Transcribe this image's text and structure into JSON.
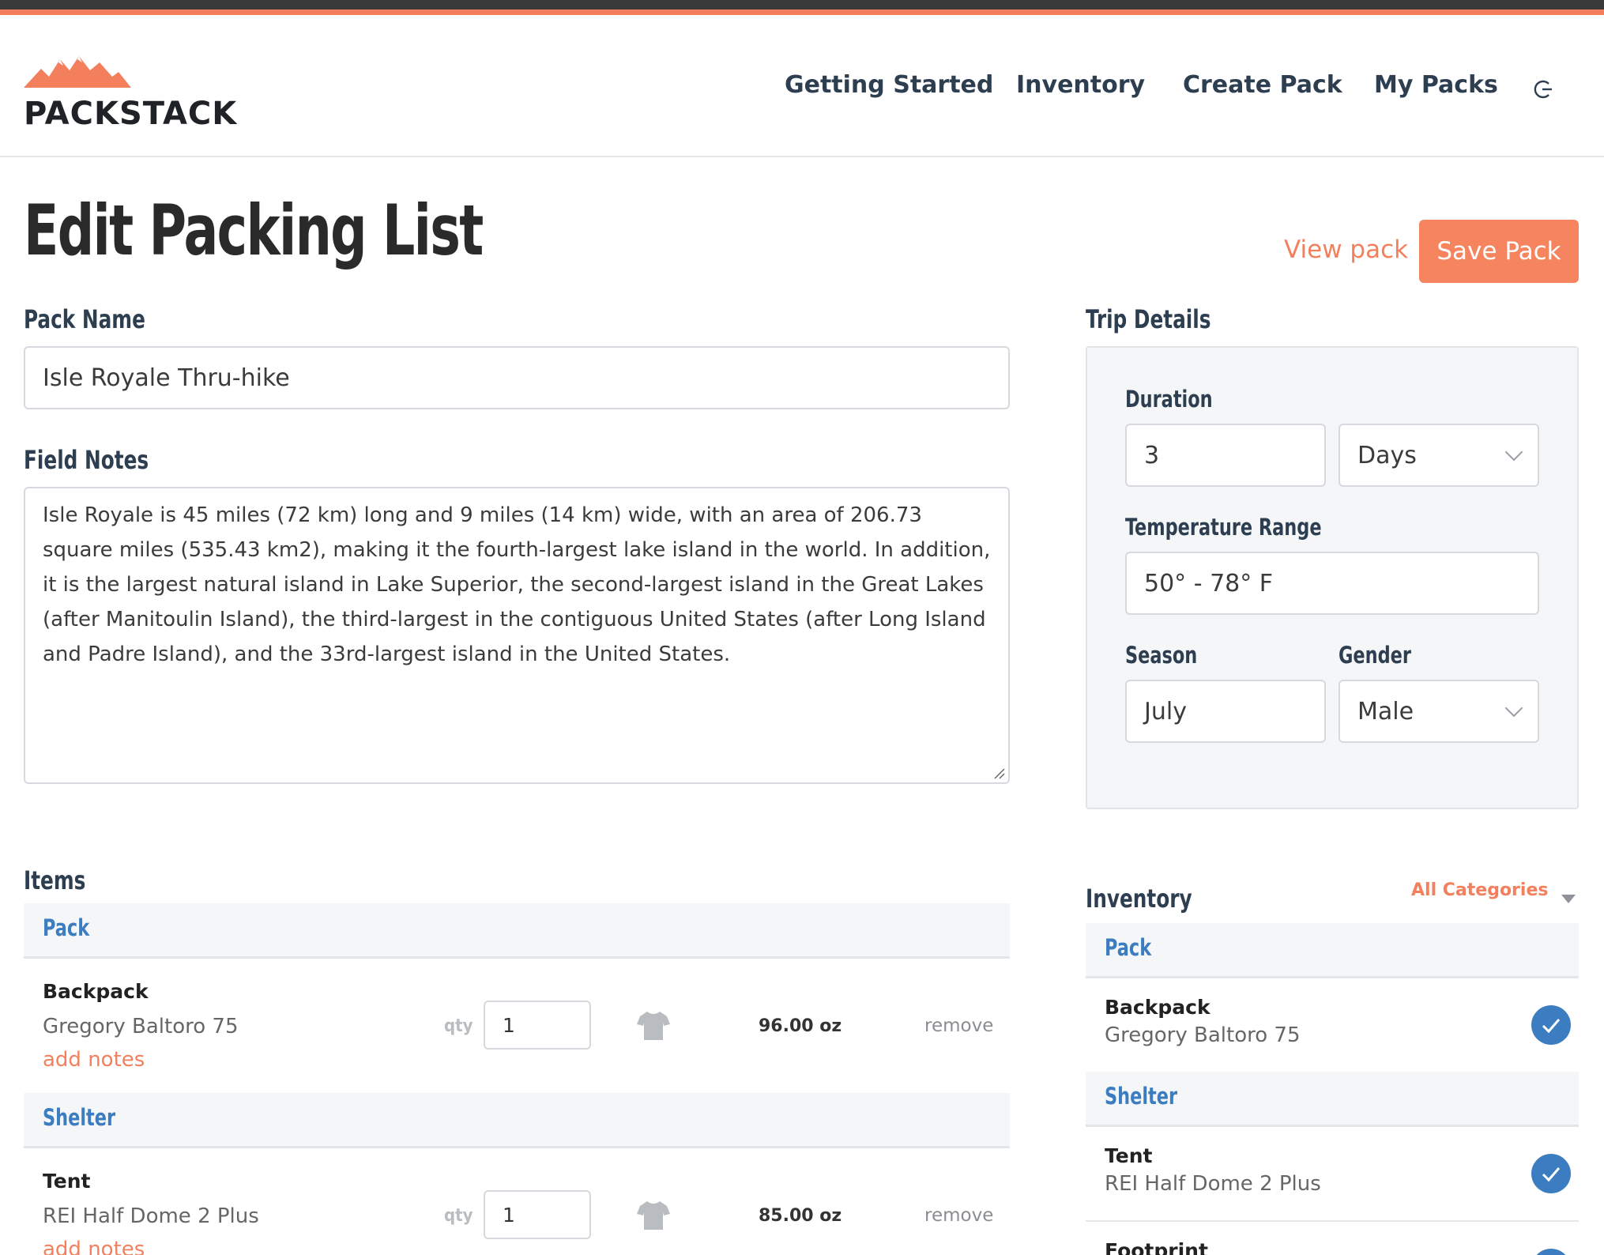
{
  "brand": {
    "name": "PACKSTACK",
    "accent": "#f37f5d",
    "link_blue": "#3b7dc0"
  },
  "nav": {
    "items": [
      "Getting Started",
      "Inventory",
      "Create Pack",
      "My Packs"
    ],
    "logout_icon": "logout-icon"
  },
  "page": {
    "title": "Edit Packing List",
    "view_pack": "View pack",
    "save_pack": "Save Pack"
  },
  "form": {
    "pack_name_label": "Pack Name",
    "pack_name_value": "Isle Royale Thru-hike",
    "field_notes_label": "Field Notes",
    "field_notes_value": "Isle Royale is 45 miles (72 km) long and 9 miles (14 km) wide, with an area of 206.73 square miles (535.43 km2), making it the fourth-largest lake island in the world. In addition, it is the largest natural island in Lake Superior, the second-largest island in the Great Lakes (after Manitoulin Island), the third-largest in the contiguous United States (after Long Island and Padre Island), and the 33rd-largest island in the United States."
  },
  "trip": {
    "heading": "Trip Details",
    "duration_label": "Duration",
    "duration_value": "3",
    "duration_unit": "Days",
    "temp_label": "Temperature Range",
    "temp_value": "50° - 78° F",
    "season_label": "Season",
    "season_value": "July",
    "gender_label": "Gender",
    "gender_value": "Male"
  },
  "items": {
    "heading": "Items",
    "qty_label": "qty",
    "add_notes": "add notes",
    "remove": "remove",
    "categories": [
      {
        "name": "Pack",
        "item": {
          "name": "Backpack",
          "model": "Gregory Baltoro 75",
          "qty": "1",
          "weight": "96.00 oz"
        }
      },
      {
        "name": "Shelter",
        "item": {
          "name": "Tent",
          "model": "REI Half Dome 2 Plus",
          "qty": "1",
          "weight": "85.00 oz"
        }
      }
    ]
  },
  "inventory": {
    "heading": "Inventory",
    "filter": "All Categories",
    "categories": [
      {
        "name": "Pack",
        "items": [
          {
            "name": "Backpack",
            "model": "Gregory Baltoro 75",
            "checked": true
          }
        ]
      },
      {
        "name": "Shelter",
        "items": [
          {
            "name": "Tent",
            "model": "REI Half Dome 2 Plus",
            "checked": true
          },
          {
            "name": "Footprint",
            "model": "",
            "checked": true
          }
        ]
      }
    ]
  }
}
